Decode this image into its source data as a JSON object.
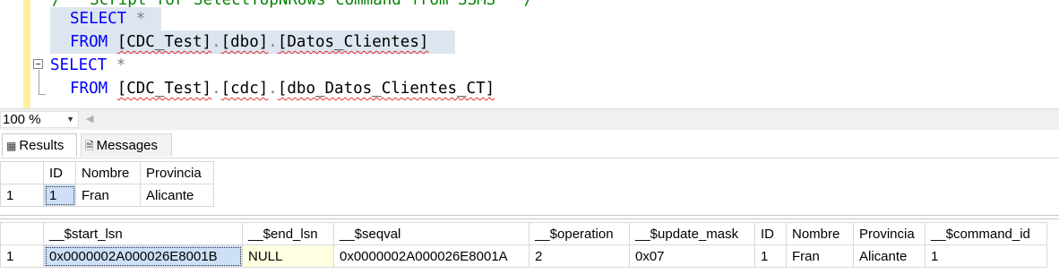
{
  "editor": {
    "line0": {
      "comment": "/*  Script for SelectTopNRows command from SSMS  */"
    },
    "line1": {
      "kw": "SELECT",
      "rest": "*"
    },
    "line2": {
      "kw": "FROM",
      "db": "[CDC_Test]",
      "schema": "[dbo]",
      "table": "[Datos_Clientes]"
    },
    "line3": {
      "kw": "SELECT",
      "rest": "*"
    },
    "line4": {
      "kw": "FROM",
      "db": "[CDC_Test]",
      "schema": "[cdc]",
      "table": "[dbo_Datos_Clientes_CT]"
    },
    "dot": "."
  },
  "zoom": {
    "value": "100 %"
  },
  "tabs": {
    "results": "Results",
    "messages": "Messages"
  },
  "grid1": {
    "columns": [
      "ID",
      "Nombre",
      "Provincia"
    ],
    "rows": [
      {
        "num": "1",
        "cells": [
          "1",
          "Fran",
          "Alicante"
        ]
      }
    ]
  },
  "grid2": {
    "columns": [
      "__$start_lsn",
      "__$end_lsn",
      "__$seqval",
      "__$operation",
      "__$update_mask",
      "ID",
      "Nombre",
      "Provincia",
      "__$command_id"
    ],
    "rows": [
      {
        "num": "1",
        "cells": [
          "0x0000002A000026E8001B",
          "NULL",
          "0x0000002A000026E8001A",
          "2",
          "0x07",
          "1",
          "Fran",
          "Alicante",
          "1"
        ]
      }
    ]
  },
  "colors": {
    "keyword": "#0000ff",
    "selection": "#cde0f7",
    "null_cell": "#ffffe1",
    "gutter_change": "#fff0a0"
  }
}
